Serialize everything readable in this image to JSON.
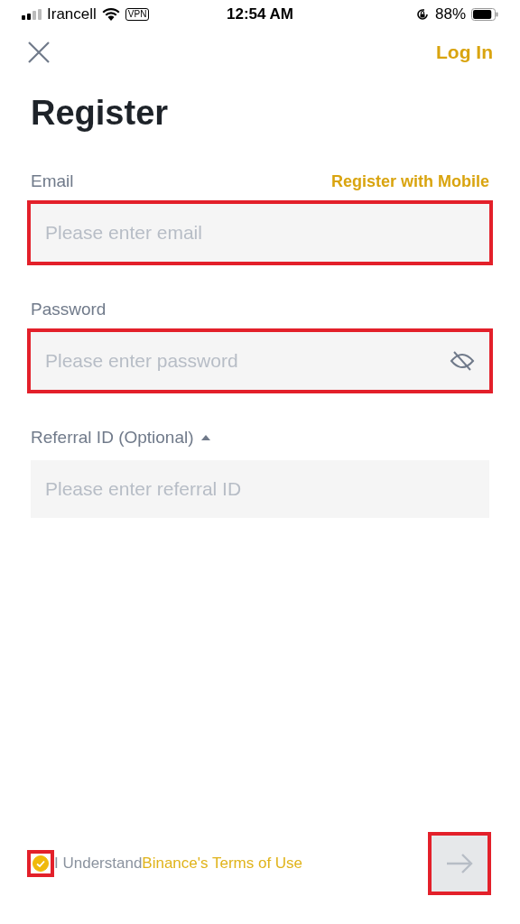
{
  "status_bar": {
    "carrier": "Irancell",
    "vpn": "VPN",
    "time": "12:54 AM",
    "battery": "88%"
  },
  "header": {
    "login": "Log In"
  },
  "title": "Register",
  "fields": [
    {
      "label": "Email",
      "link": "Register with Mobile",
      "placeholder": "Please enter email",
      "highlighted": true,
      "kind": "text"
    },
    {
      "label": "Password",
      "placeholder": "Please enter password",
      "highlighted": true,
      "kind": "password"
    },
    {
      "label": "Referral ID (Optional)",
      "placeholder": "Please enter referral ID",
      "highlighted": false,
      "kind": "referral",
      "expanded": true
    }
  ],
  "terms": {
    "checked": true,
    "highlighted": true,
    "text": "I Understand",
    "link": "Binance's Terms of Use"
  },
  "next_button": {
    "disabled": true,
    "highlighted": true
  }
}
